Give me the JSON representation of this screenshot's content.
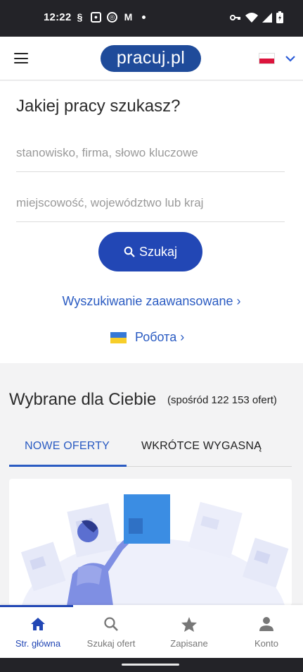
{
  "status_bar": {
    "time": "12:22",
    "notification_icons": [
      "s-app-icon",
      "camera-app-icon",
      "chrome-icon",
      "gmail-icon"
    ],
    "system_icons": [
      "vpn-key-icon",
      "wifi-icon",
      "signal-icon",
      "battery-charging-icon"
    ]
  },
  "header": {
    "logo_text": "pracuj.pl",
    "language": "PL"
  },
  "search": {
    "title": "Jakiej pracy szukasz?",
    "keyword_placeholder": "stanowisko, firma, słowo kluczowe",
    "location_placeholder": "miejscowość, województwo lub kraj",
    "button_label": "Szukaj",
    "advanced_link": "Wyszukiwanie zaawansowane ›",
    "robota_link": "Робота ›"
  },
  "recommendations": {
    "title": "Wybrane dla Ciebie",
    "count_text": "(spośród 122 153 ofert)",
    "tabs": [
      {
        "label": "NOWE OFERTY",
        "active": true
      },
      {
        "label": "WKRÓTCE WYGASNĄ",
        "active": false
      }
    ]
  },
  "bottom_nav": {
    "items": [
      {
        "label": "Str. główna",
        "icon": "home-icon",
        "active": true
      },
      {
        "label": "Szukaj ofert",
        "icon": "search-icon",
        "active": false
      },
      {
        "label": "Zapisane",
        "icon": "star-icon",
        "active": false
      },
      {
        "label": "Konto",
        "icon": "person-icon",
        "active": false
      }
    ]
  },
  "colors": {
    "brand_blue": "#1f4b9a",
    "button_blue": "#2247b5",
    "link_blue": "#2a5bc2"
  }
}
